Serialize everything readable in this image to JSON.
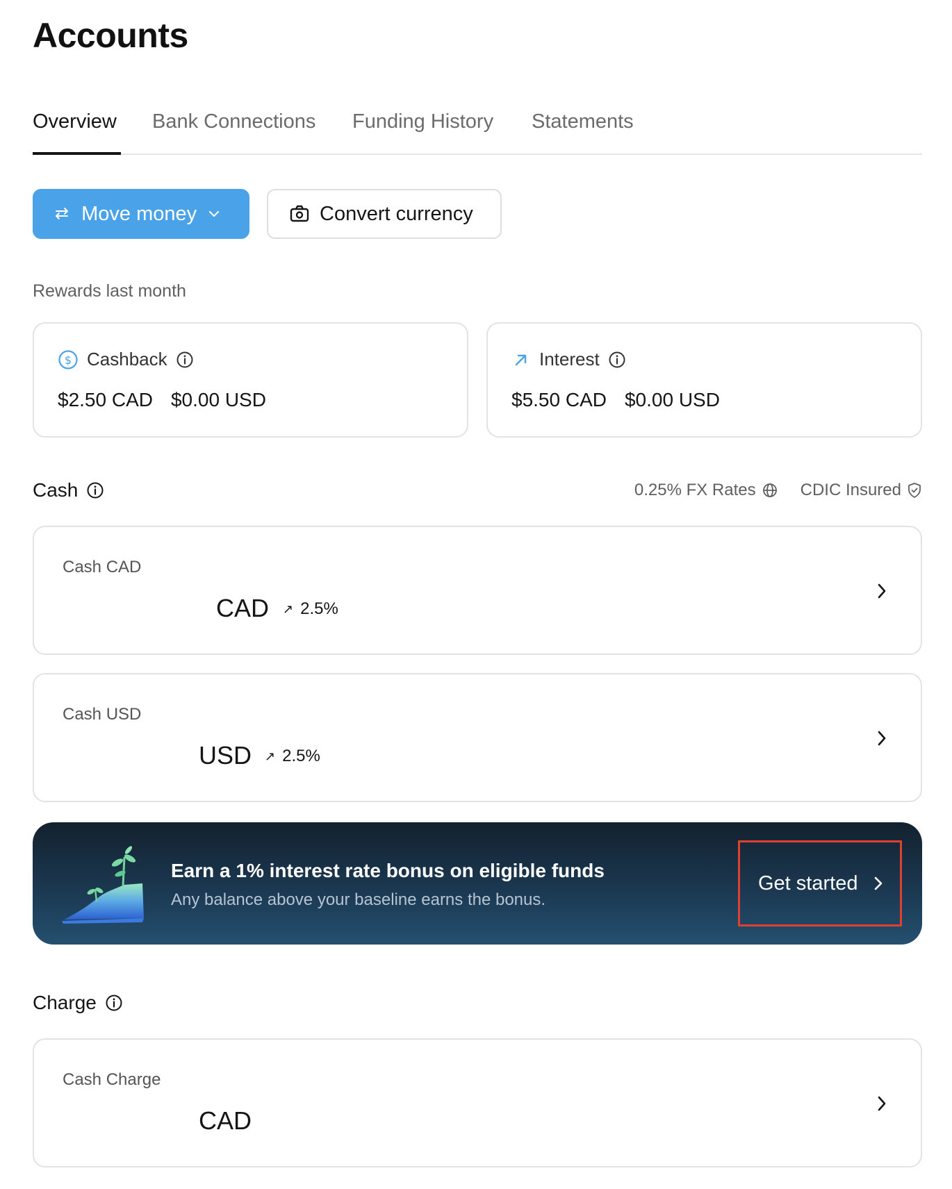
{
  "page": {
    "title": "Accounts"
  },
  "tabs": [
    {
      "label": "Overview",
      "active": true
    },
    {
      "label": "Bank Connections",
      "active": false
    },
    {
      "label": "Funding History",
      "active": false
    },
    {
      "label": "Statements",
      "active": false
    }
  ],
  "actions": {
    "move_money": "Move money",
    "convert_currency": "Convert currency"
  },
  "rewards": {
    "section_label": "Rewards last month",
    "cashback": {
      "label": "Cashback",
      "icon": "dollar-circle-icon",
      "cad": "$2.50 CAD",
      "usd": "$0.00 USD"
    },
    "interest": {
      "label": "Interest",
      "icon": "arrow-up-right-icon",
      "cad": "$5.50 CAD",
      "usd": "$0.00 USD"
    }
  },
  "cash": {
    "title": "Cash",
    "fx_rates": "0.25% FX Rates",
    "insured": "CDIC Insured",
    "accounts": [
      {
        "name": "Cash CAD",
        "currency": "CAD",
        "rate": "2.5%"
      },
      {
        "name": "Cash USD",
        "currency": "USD",
        "rate": "2.5%"
      }
    ]
  },
  "promo": {
    "title": "Earn a 1% interest rate bonus on eligible funds",
    "subtitle": "Any balance above your baseline earns the bonus.",
    "cta": "Get started"
  },
  "charge": {
    "title": "Charge",
    "accounts": [
      {
        "name": "Cash Charge",
        "currency": "CAD"
      }
    ]
  },
  "colors": {
    "primary": "#4aa3e8",
    "promo_bg": "#1c3a54",
    "highlight": "#e0412f"
  }
}
